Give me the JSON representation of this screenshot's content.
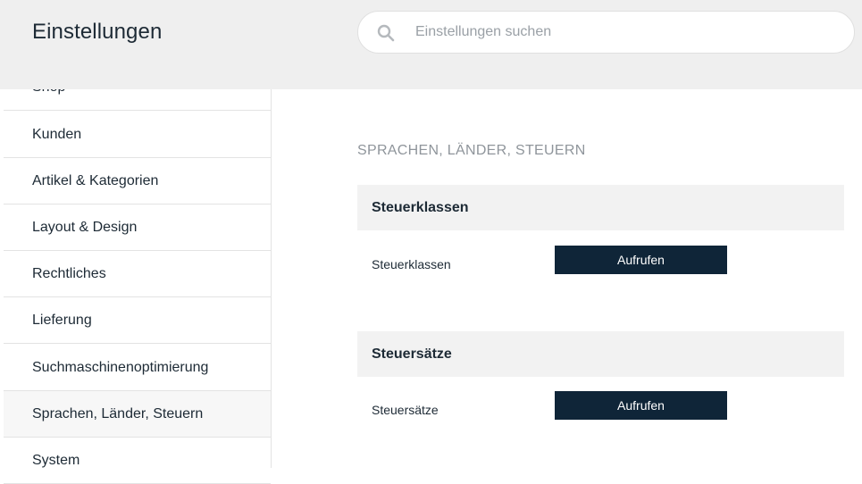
{
  "header": {
    "title": "Einstellungen",
    "search": {
      "placeholder": "Einstellungen suchen",
      "value": ""
    }
  },
  "sidebar": {
    "items": [
      {
        "label": "Shop"
      },
      {
        "label": "Kunden"
      },
      {
        "label": "Artikel & Kategorien"
      },
      {
        "label": "Layout & Design"
      },
      {
        "label": "Rechtliches"
      },
      {
        "label": "Lieferung"
      },
      {
        "label": "Suchmaschinenoptimierung"
      },
      {
        "label": "Sprachen, Länder, Steuern",
        "active": true
      },
      {
        "label": "System"
      }
    ]
  },
  "main": {
    "section_title": "SPRACHEN, LÄNDER, STEUERN",
    "cards": [
      {
        "title": "Steuerklassen",
        "row_label": "Steuerklassen",
        "button_label": "Aufrufen"
      },
      {
        "title": "Steuersätze",
        "row_label": "Steuersätze",
        "button_label": "Aufrufen"
      }
    ]
  },
  "colors": {
    "header_bg": "#efefef",
    "button_bg": "#0f2538",
    "card_head_bg": "#f2f2f2"
  }
}
